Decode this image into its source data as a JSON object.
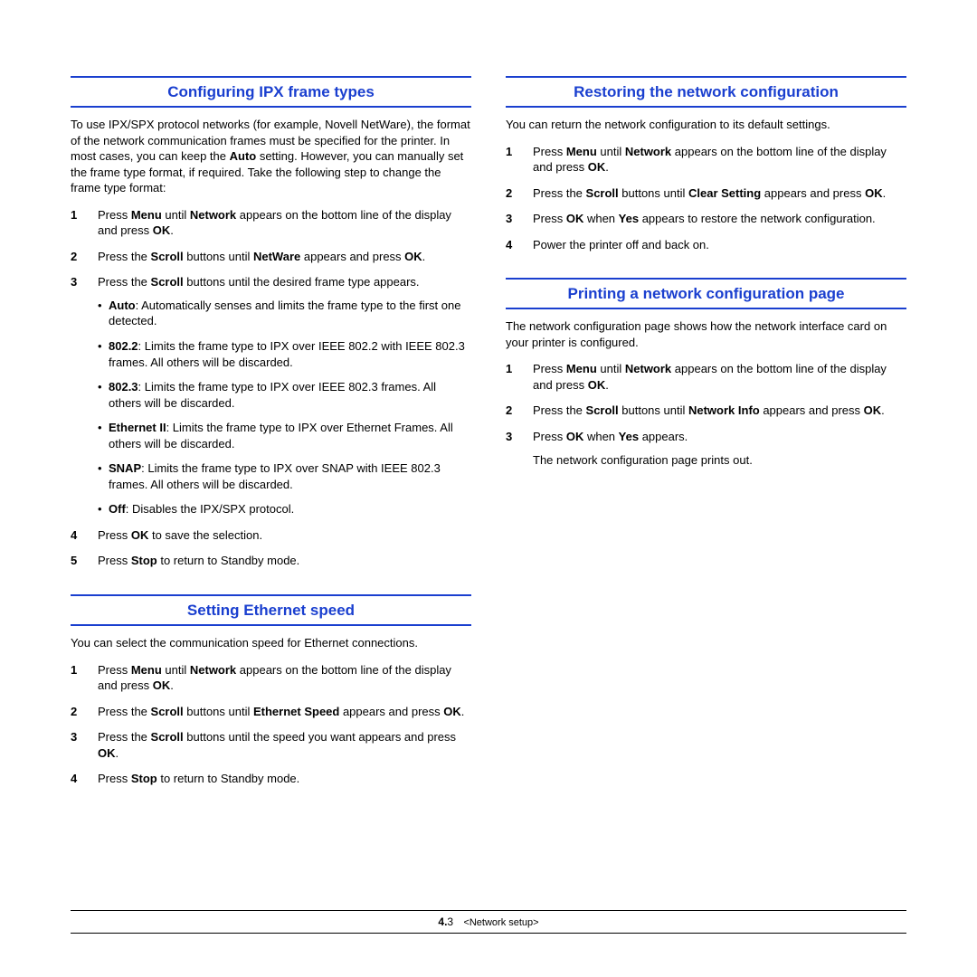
{
  "left": {
    "sec1": {
      "heading": "Configuring IPX frame types",
      "intro_pre": "To use IPX/SPX protocol networks (for example, Novell NetWare), the format of the network communication frames must be specified for the printer. In most cases, you can keep the ",
      "intro_bold": "Auto",
      "intro_post": " setting. However, you can manually set the frame type format, if required. Take the following step to change the frame type format:",
      "s1_a": "Press ",
      "s1_b": "Menu",
      "s1_c": " until ",
      "s1_d": "Network",
      "s1_e": " appears on the bottom line of the display and press ",
      "s1_f": "OK",
      "s1_g": ".",
      "s2_a": "Press the ",
      "s2_b": "Scroll",
      "s2_c": " buttons until ",
      "s2_d": "NetWare",
      "s2_e": " appears and press ",
      "s2_f": "OK",
      "s2_g": ".",
      "s3_a": "Press the ",
      "s3_b": "Scroll",
      "s3_c": " buttons until the desired frame type appears.",
      "b1_a": "Auto",
      "b1_b": ": Automatically senses and limits the frame type to the first one detected.",
      "b2_a": "802.2",
      "b2_b": ": Limits the frame type to IPX over IEEE 802.2 with IEEE 802.3 frames. All others will be discarded.",
      "b3_a": "802.3",
      "b3_b": ": Limits the frame type to IPX over IEEE 802.3 frames. All others will be discarded.",
      "b4_a": "Ethernet II",
      "b4_b": ": Limits the frame type to IPX over Ethernet Frames. All others will be discarded.",
      "b5_a": "SNAP",
      "b5_b": ": Limits the frame type to IPX over SNAP with IEEE 802.3 frames. All others will be discarded.",
      "b6_a": "Off",
      "b6_b": ": Disables the IPX/SPX protocol.",
      "s4_a": "Press ",
      "s4_b": "OK",
      "s4_c": " to save the selection.",
      "s5_a": "Press ",
      "s5_b": "Stop",
      "s5_c": " to return to Standby mode."
    },
    "sec2": {
      "heading": "Setting Ethernet speed",
      "intro": "You can select the communication speed for Ethernet connections.",
      "s1_a": "Press ",
      "s1_b": "Menu",
      "s1_c": " until ",
      "s1_d": "Network",
      "s1_e": " appears on the bottom line of the display and press ",
      "s1_f": "OK",
      "s1_g": ".",
      "s2_a": "Press the ",
      "s2_b": "Scroll",
      "s2_c": " buttons until ",
      "s2_d": "Ethernet Speed",
      "s2_e": " appears and press ",
      "s2_f": "OK",
      "s2_g": ".",
      "s3_a": "Press the ",
      "s3_b": "Scroll",
      "s3_c": " buttons until the speed you want appears and press ",
      "s3_d": "OK",
      "s3_e": ".",
      "s4_a": "Press ",
      "s4_b": "Stop",
      "s4_c": " to return to Standby mode."
    }
  },
  "right": {
    "sec1": {
      "heading": "Restoring the network configuration",
      "intro": "You can return the network configuration to its default settings.",
      "s1_a": "Press ",
      "s1_b": "Menu",
      "s1_c": " until ",
      "s1_d": "Network",
      "s1_e": " appears on the bottom line of the display and press ",
      "s1_f": "OK",
      "s1_g": ".",
      "s2_a": "Press the ",
      "s2_b": "Scroll",
      "s2_c": " buttons until ",
      "s2_d": "Clear Setting",
      "s2_e": " appears and press ",
      "s2_f": "OK",
      "s2_g": ".",
      "s3_a": "Press ",
      "s3_b": "OK",
      "s3_c": " when ",
      "s3_d": "Yes",
      "s3_e": " appears to restore the network configuration.",
      "s4": "Power the printer off and back on."
    },
    "sec2": {
      "heading": "Printing a network configuration page",
      "intro": "The network configuration page shows how the network interface card on your printer is configured.",
      "s1_a": "Press ",
      "s1_b": "Menu",
      "s1_c": " until ",
      "s1_d": "Network",
      "s1_e": " appears on the bottom line of the display and press ",
      "s1_f": "OK",
      "s1_g": ".",
      "s2_a": "Press the ",
      "s2_b": "Scroll",
      "s2_c": " buttons until ",
      "s2_d": "Network Info",
      "s2_e": " appears and press ",
      "s2_f": "OK",
      "s2_g": ".",
      "s3_a": "Press ",
      "s3_b": "OK",
      "s3_c": " when ",
      "s3_d": "Yes",
      "s3_e": " appears.",
      "after": "The network configuration page prints out."
    }
  },
  "footer": {
    "chapter": "4.",
    "page": "3",
    "name": "<Network setup>"
  }
}
